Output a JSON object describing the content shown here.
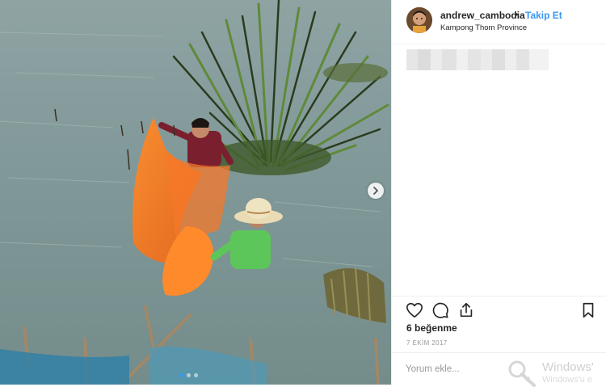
{
  "post": {
    "username": "andrew_cambodia",
    "separator": "•",
    "follow_label": "Takip Et",
    "location": "Kampong Thom Province",
    "likes_text": "6 beğenme",
    "date": "7 EKİM 2017",
    "comment_placeholder": "Yorum ekle...",
    "carousel_total_slides": 3,
    "carousel_active_index": 0
  },
  "icons": {
    "like": "heart-icon",
    "comment": "comment-bubble-icon",
    "share": "share-icon",
    "save": "bookmark-icon",
    "next": "chevron-right-icon"
  },
  "watermark": {
    "line1": "Windows'",
    "line2": "Windows'u e"
  },
  "colors": {
    "link_blue": "#3897f0",
    "text_dark": "#262626",
    "muted": "#999999",
    "border": "#efefef"
  }
}
